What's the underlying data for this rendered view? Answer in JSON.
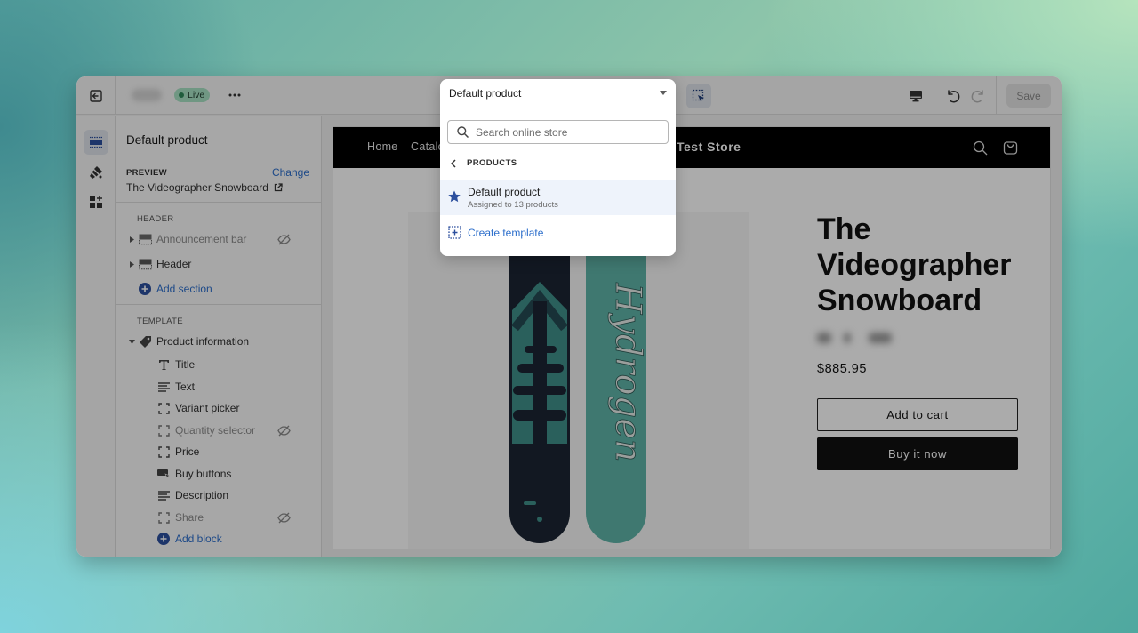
{
  "topbar": {
    "exit_label": "Exit editor",
    "status_badge": "Live",
    "more_label": "•••",
    "save_label": "Save"
  },
  "rail": {
    "items": [
      {
        "icon": "sections-icon",
        "label": "Sections",
        "active": true
      },
      {
        "icon": "theme-settings-icon",
        "label": "Theme settings",
        "active": false
      },
      {
        "icon": "app-embeds-icon",
        "label": "App embeds",
        "active": false
      }
    ]
  },
  "sidebar": {
    "title": "Default product",
    "preview_label": "PREVIEW",
    "change_label": "Change",
    "preview_value": "The Videographer Snowboard",
    "header_group_label": "HEADER",
    "header_sections": [
      {
        "label": "Announcement bar",
        "hidden": true
      },
      {
        "label": "Header",
        "hidden": false
      }
    ],
    "add_section_label": "Add section",
    "template_group_label": "TEMPLATE",
    "template_section": "Product information",
    "blocks": [
      {
        "label": "Title",
        "icon": "title-icon",
        "hidden": false
      },
      {
        "label": "Text",
        "icon": "text-icon",
        "hidden": false
      },
      {
        "label": "Variant picker",
        "icon": "block-icon",
        "hidden": false
      },
      {
        "label": "Quantity selector",
        "icon": "block-icon",
        "hidden": true
      },
      {
        "label": "Price",
        "icon": "block-icon",
        "hidden": false
      },
      {
        "label": "Buy buttons",
        "icon": "buy-buttons-icon",
        "hidden": false
      },
      {
        "label": "Description",
        "icon": "text-icon",
        "hidden": false
      },
      {
        "label": "Share",
        "icon": "block-icon",
        "hidden": true
      }
    ],
    "add_block_label": "Add block"
  },
  "template_picker": {
    "selected": "Default product",
    "search_placeholder": "Search online store",
    "back_label": "PRODUCTS",
    "items": [
      {
        "name": "Default product",
        "subtitle": "Assigned to 13 products",
        "default": true
      }
    ],
    "create_label": "Create template"
  },
  "store": {
    "nav": [
      "Home",
      "Catalog"
    ],
    "logo": "Test Store",
    "product": {
      "title": "The Videographer Snowboard",
      "price": "$885.95",
      "add_to_cart": "Add to cart",
      "buy_now": "Buy it now",
      "image_text": "Hydrogen"
    }
  },
  "colors": {
    "accent": "#2c6ecb",
    "live_badge": "#a8e1c4",
    "store_header": "#000000",
    "board_dark": "#1b2533",
    "board_teal": "#5fb3a8"
  }
}
